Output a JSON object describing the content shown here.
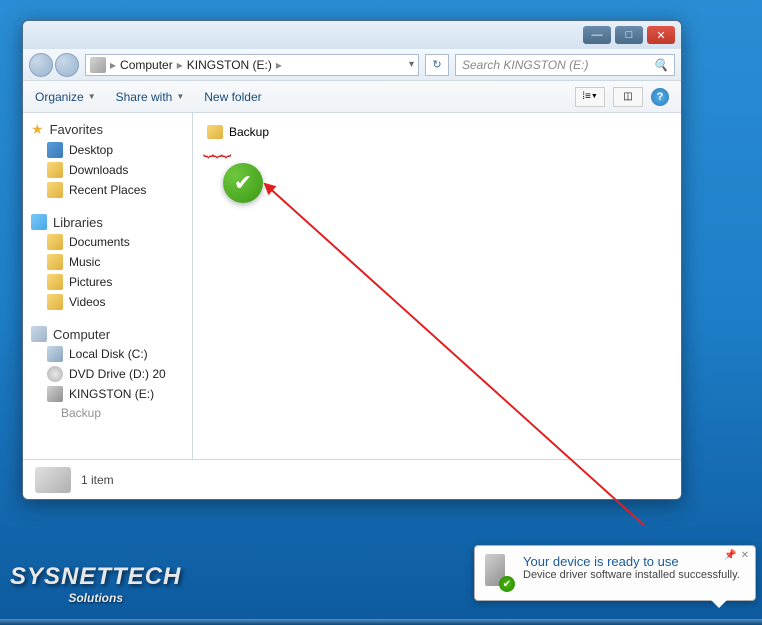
{
  "breadcrumb": {
    "root": "Computer",
    "drive": "KINGSTON (E:)"
  },
  "search": {
    "placeholder": "Search KINGSTON (E:)"
  },
  "toolbar": {
    "organize": "Organize",
    "share": "Share with",
    "newfolder": "New folder"
  },
  "sidebar": {
    "favorites": {
      "header": "Favorites",
      "items": [
        "Desktop",
        "Downloads",
        "Recent Places"
      ]
    },
    "libraries": {
      "header": "Libraries",
      "items": [
        "Documents",
        "Music",
        "Pictures",
        "Videos"
      ]
    },
    "computer": {
      "header": "Computer",
      "items": [
        "Local Disk (C:)",
        "DVD Drive (D:) 20",
        "KINGSTON (E:)",
        "Backup"
      ]
    }
  },
  "content": {
    "folder": "Backup"
  },
  "status": {
    "count": "1 item"
  },
  "notification": {
    "title": "Your device is ready to use",
    "body": "Device driver software installed successfully."
  },
  "watermark": {
    "line1": "SYSNETTECH",
    "line2": "Solutions"
  }
}
